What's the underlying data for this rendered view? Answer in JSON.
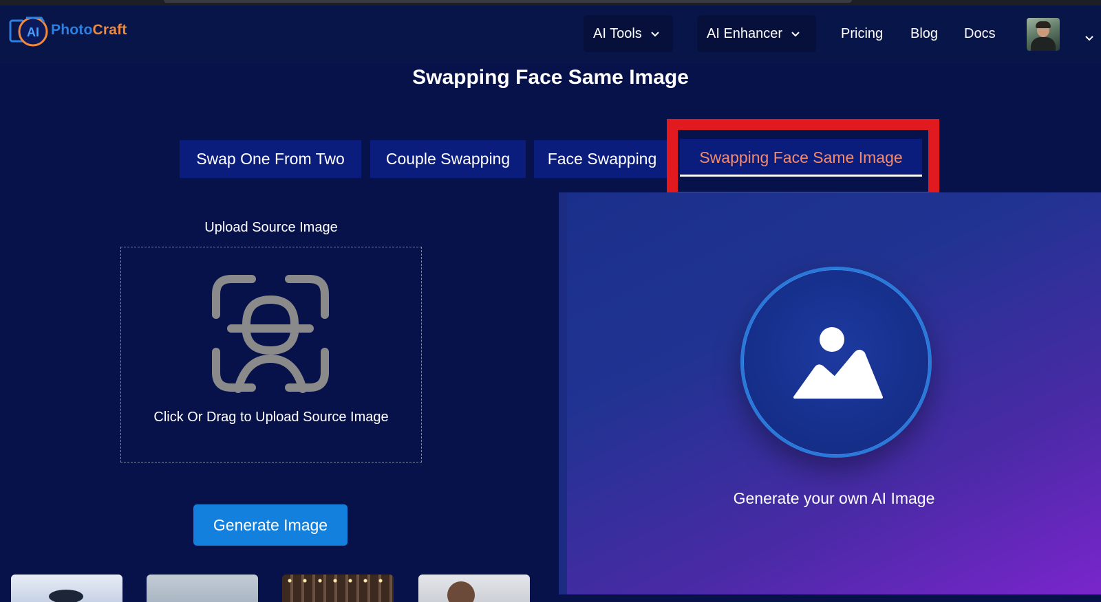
{
  "brand": {
    "logo_badge_text": "AI",
    "logo_text_part1": "Photo",
    "logo_text_part2": "Craft"
  },
  "nav": {
    "ai_tools_label": "AI Tools",
    "ai_enhancer_label": "AI Enhancer",
    "pricing_label": "Pricing",
    "blog_label": "Blog",
    "docs_label": "Docs"
  },
  "page": {
    "title": "Swapping Face Same Image"
  },
  "tabs": [
    {
      "label": "Swap One From Two",
      "active": false
    },
    {
      "label": "Couple Swapping",
      "active": false
    },
    {
      "label": "Face Swapping",
      "active": false
    },
    {
      "label": "Swapping Face Same Image",
      "active": true
    }
  ],
  "upload": {
    "label": "Upload Source Image",
    "hint": "Click Or Drag to Upload Source Image"
  },
  "actions": {
    "generate_label": "Generate Image"
  },
  "result_panel": {
    "caption": "Generate your own AI Image"
  },
  "icons": {
    "upload": "face-scan-icon",
    "result": "image-placeholder-icon",
    "dropdown": "chevron-down-icon"
  },
  "colors": {
    "background": "#07124a",
    "tab_bg": "#0b1d7c",
    "active_tab_text": "#f58a6a",
    "highlight": "#e11a1f",
    "button": "#1380dd"
  }
}
